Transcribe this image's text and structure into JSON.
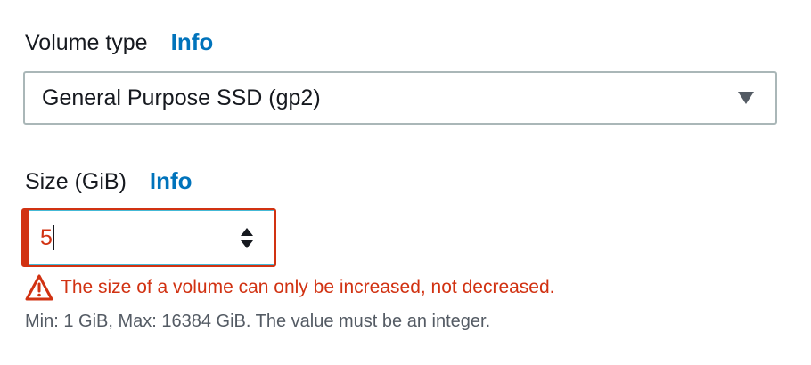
{
  "volume_type": {
    "label": "Volume type",
    "info_label": "Info",
    "selected_value": "General Purpose SSD (gp2)"
  },
  "size": {
    "label": "Size (GiB)",
    "info_label": "Info",
    "value": "5",
    "error_message": "The size of a volume can only be increased, not decreased.",
    "constraint": "Min: 1 GiB, Max: 16384 GiB. The value must be an integer."
  },
  "colors": {
    "info_link": "#0073bb",
    "error": "#d13212",
    "text": "#16191f",
    "secondary_text": "#545b64",
    "border": "#aab7b8"
  },
  "icons": {
    "select_caret": "caret-down-icon",
    "stepper": "spinner-icon",
    "error": "warning-icon"
  }
}
